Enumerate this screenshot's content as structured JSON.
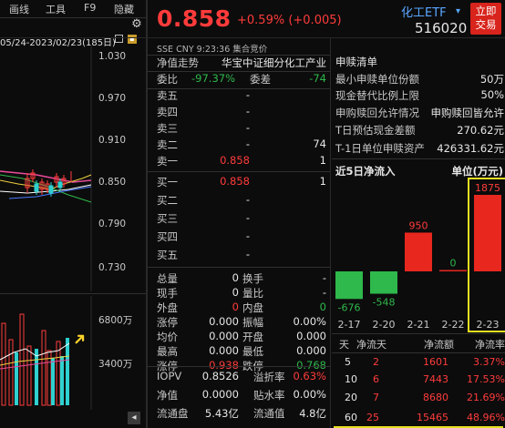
{
  "toolbar": {
    "items": [
      "画线",
      "工具",
      "F9",
      "隐藏"
    ]
  },
  "left_chart": {
    "date_range": "05/24-2023/02/23(185日)",
    "price_axis": [
      "1.030",
      "0.970",
      "0.910",
      "0.850",
      "0.790",
      "0.730"
    ],
    "volume_axis": [
      "6800万",
      "3400万"
    ]
  },
  "quote": {
    "price": "0.858",
    "change": "+0.59% (+0.005)",
    "sub_info": "SSE  CNY  9:23:36  集合竞价",
    "trend_label": "净值走势",
    "index_name": "华宝中证细分化工产业",
    "weibi_label": "委比",
    "weibi_value": "-97.37%",
    "weicha_label": "委差",
    "weicha_value": "-74"
  },
  "order_book": {
    "sell": [
      {
        "label": "卖五",
        "price": "-",
        "vol": ""
      },
      {
        "label": "卖四",
        "price": "-",
        "vol": ""
      },
      {
        "label": "卖三",
        "price": "-",
        "vol": ""
      },
      {
        "label": "卖二",
        "price": "-",
        "vol": "74"
      },
      {
        "label": "卖一",
        "price": "0.858",
        "vol": "1"
      }
    ],
    "buy": [
      {
        "label": "买一",
        "price": "0.858",
        "vol": "1"
      },
      {
        "label": "买二",
        "price": "-",
        "vol": ""
      },
      {
        "label": "买三",
        "price": "-",
        "vol": ""
      },
      {
        "label": "买四",
        "price": "-",
        "vol": ""
      },
      {
        "label": "买五",
        "price": "-",
        "vol": ""
      }
    ]
  },
  "stats": [
    {
      "l1": "总量",
      "v1": "0",
      "l2": "换手",
      "v2": "-"
    },
    {
      "l1": "现手",
      "v1": "0",
      "l2": "量比",
      "v2": "-"
    },
    {
      "l1": "外盘",
      "v1": "0",
      "l2": "内盘",
      "v2": "0"
    },
    {
      "l1": "涨停",
      "v1": "0.000",
      "l2": "振幅",
      "v2": "0.00%"
    },
    {
      "l1": "均价",
      "v1": "0.000",
      "l2": "开盘",
      "v2": "0.000"
    },
    {
      "l1": "最高",
      "v1": "0.000",
      "l2": "最低",
      "v2": "0.000"
    },
    {
      "l1": "涨停",
      "v1": "0.938",
      "l2": "跌停",
      "v2": "0.768"
    }
  ],
  "bottom_stats": [
    {
      "l1": "IOPV",
      "v1": "0.8526",
      "l2": "溢折率",
      "v2": "0.63%"
    },
    {
      "l1": "净值",
      "v1": "0.0000",
      "l2": "贴水率",
      "v2": "0.00%"
    },
    {
      "l1": "流通盘",
      "v1": "5.43亿",
      "l2": "流通值",
      "v2": "4.8亿"
    }
  ],
  "header": {
    "title": "化工ETF",
    "code": "516020",
    "trade_btn_line1": "立即",
    "trade_btn_line2": "交易"
  },
  "subscribe": {
    "title": "申赎清单",
    "rows": [
      {
        "label": "最小申赎单位份额",
        "value": "50万"
      },
      {
        "label": "现金替代比例上限",
        "value": "50%"
      },
      {
        "label": "申购赎回允许情况",
        "value": "申购赎回皆允许"
      },
      {
        "label": "T日预估现金差额",
        "value": "270.62元"
      },
      {
        "label": "T-1日单位申赎资产",
        "value": "426331.62元"
      }
    ]
  },
  "inflow": {
    "title": "近5日净流入",
    "unit": "单位(万元)"
  },
  "chart_data": {
    "type": "bar",
    "title": "近5日净流入",
    "unit": "单位(万元)",
    "categories": [
      "2-17",
      "2-20",
      "2-21",
      "2-22",
      "2-23"
    ],
    "values": [
      -676,
      -548,
      950,
      0,
      1875
    ],
    "labels": [
      "-676",
      "-548",
      "950",
      "0",
      "1875"
    ],
    "colors": {
      "positive": "#e8271f",
      "negative": "#2fb84b",
      "highlight_box": "#e6e020"
    }
  },
  "inflow_table": {
    "headers": [
      "天",
      "净流天",
      "净流额",
      "净流率"
    ],
    "rows": [
      [
        "5",
        "2",
        "1601",
        "3.37%"
      ],
      [
        "10",
        "6",
        "7443",
        "17.53%"
      ],
      [
        "20",
        "7",
        "8680",
        "21.69%"
      ],
      [
        "60",
        "25",
        "15465",
        "48.96%"
      ]
    ]
  }
}
